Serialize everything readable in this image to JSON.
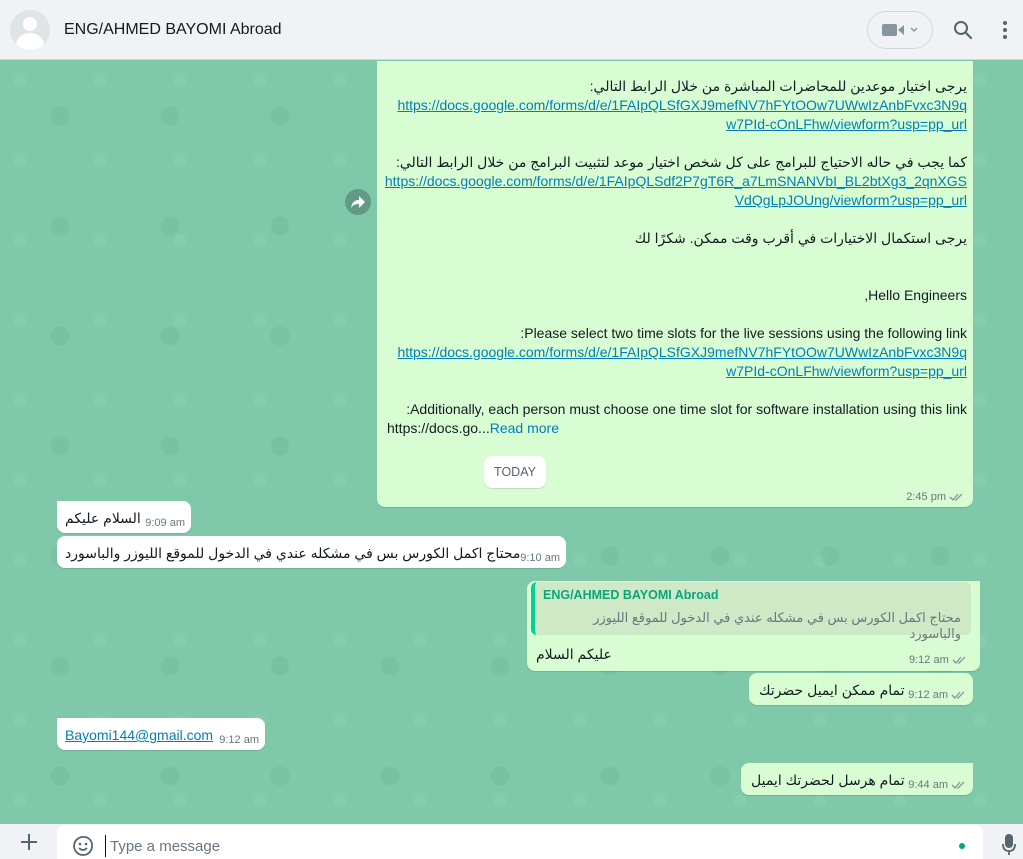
{
  "header": {
    "chat_title": "ENG/AHMED BAYOMI Abroad"
  },
  "messages": {
    "forwarded": {
      "lines": [
        "يرجى اختيار موعدين للمحاضرات المباشرة من خلال الرابط التالي:",
        "https://docs.google.com/forms/d/e/1FAIpQLSfGXJ9mefNV7hFYtOOw7UWwIzAnbFvxc3N9q",
        "w7PId-cOnLFhw/viewform?usp=pp_url",
        "كما يجب في حاله الاحتياج للبرامج على كل شخص اختيار موعد لتثبيت  البرامج من خلال الرابط التالي:",
        "https://docs.google.com/forms/d/e/1FAIpQLSdf2P7gT6R_a7LmSNANVbI_BL2btXg3_2qnXGS",
        "VdQgLpJOUng/viewform?usp=pp_url",
        "يرجى استكمال الاختيارات في أقرب وقت ممكن. شكرًا لك",
        "Hello Engineers,",
        "Please select two time slots for the live sessions using the following link:",
        "https://docs.google.com/forms/d/e/1FAIpQLSfGXJ9mefNV7hFYtOOw7UWwIzAnbFvxc3N9q",
        "w7PId-cOnLFhw/viewform?usp=pp_url",
        "Additionally, each person must choose one time slot for software installation using this link:",
        "https://docs.go..."
      ],
      "read_more": "Read more",
      "time": "2:45 pm"
    },
    "date_divider": "TODAY",
    "in1": {
      "text": "السلام عليكم",
      "time": "9:09 am"
    },
    "in2": {
      "text": "محتاج اكمل الكورس بس في مشكله عندي في الدخول للموقع الليوزر والباسورد",
      "time": "9:10 am"
    },
    "out1": {
      "quote_name": "ENG/AHMED BAYOMI Abroad",
      "quote_text": "محتاج اكمل الكورس بس في مشكله عندي في الدخول للموقع الليوزر والباسورد",
      "text": "عليكم السلام",
      "time": "9:12 am"
    },
    "out2": {
      "text": "تمام ممكن ايميل حضرتك",
      "time": "9:12 am"
    },
    "in3": {
      "text": "Bayomi144@gmail.com",
      "time": "9:12 am"
    },
    "out3": {
      "text": "تمام هرسل لحضرتك ايميل",
      "time": "9:44 am"
    }
  },
  "composer": {
    "placeholder": "Type a message"
  },
  "colors": {
    "wallpaper": "#7fc8a9",
    "outgoing": "#d9fdd3",
    "incoming": "#ffffff",
    "link": "#027eb5",
    "accent": "#00a884"
  }
}
